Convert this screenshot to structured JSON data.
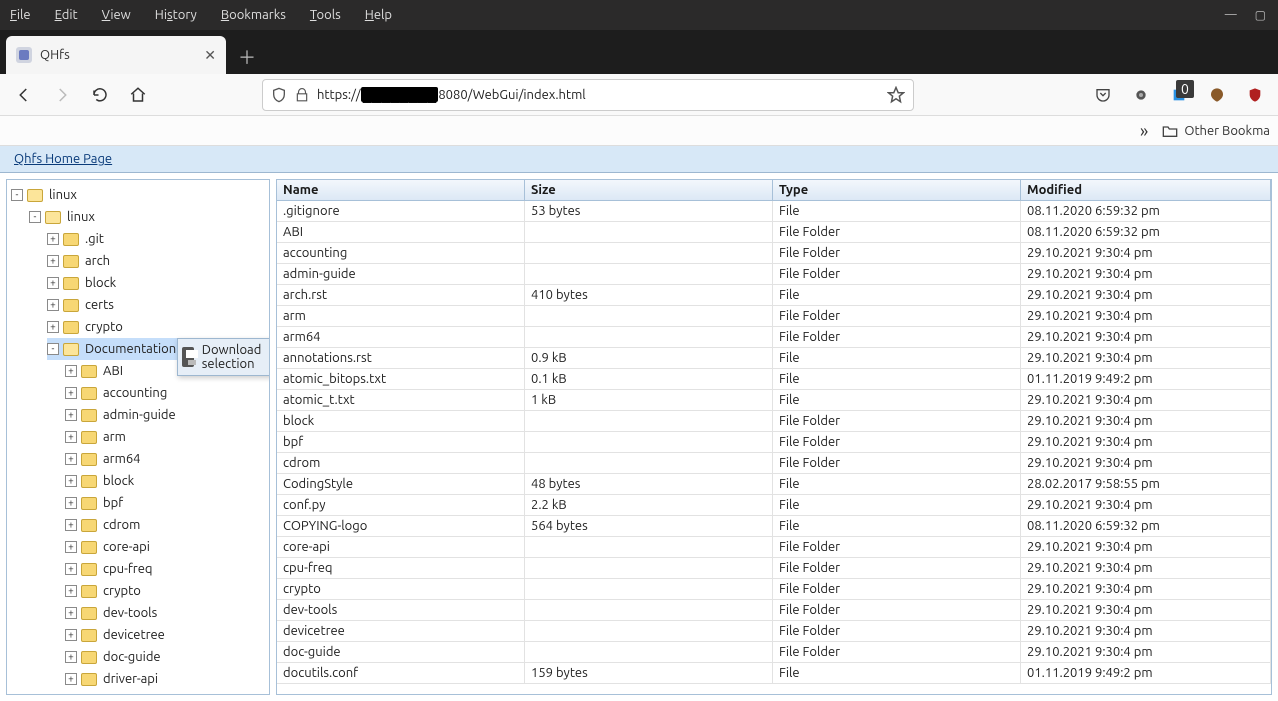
{
  "chrome": {
    "menus": [
      {
        "label": "File",
        "accel": "F"
      },
      {
        "label": "Edit",
        "accel": "E"
      },
      {
        "label": "View",
        "accel": "V"
      },
      {
        "label": "History",
        "accel": "s"
      },
      {
        "label": "Bookmarks",
        "accel": "B"
      },
      {
        "label": "Tools",
        "accel": "T"
      },
      {
        "label": "Help",
        "accel": "H"
      }
    ],
    "tab_title": "QHfs",
    "url_prefix": "https://",
    "url_redacted": "████████",
    "url_suffix": "8080/WebGui/index.html",
    "pocket_badge": "0",
    "bookmarks_overflow_label": "Other Bookma"
  },
  "page": {
    "home_link": "Qhfs Home Page",
    "ctx_download": "Download selection"
  },
  "tree": [
    {
      "depth": 0,
      "exp": "-",
      "open": true,
      "label": "linux",
      "selected": false
    },
    {
      "depth": 1,
      "exp": "-",
      "open": true,
      "label": "linux",
      "selected": false
    },
    {
      "depth": 2,
      "exp": "+",
      "open": false,
      "label": ".git",
      "selected": false
    },
    {
      "depth": 2,
      "exp": "+",
      "open": false,
      "label": "arch",
      "selected": false
    },
    {
      "depth": 2,
      "exp": "+",
      "open": false,
      "label": "block",
      "selected": false
    },
    {
      "depth": 2,
      "exp": "+",
      "open": false,
      "label": "certs",
      "selected": false
    },
    {
      "depth": 2,
      "exp": "+",
      "open": false,
      "label": "crypto",
      "selected": false
    },
    {
      "depth": 2,
      "exp": "-",
      "open": true,
      "label": "Documentation",
      "selected": true
    },
    {
      "depth": 3,
      "exp": "+",
      "open": false,
      "label": "ABI",
      "selected": false
    },
    {
      "depth": 3,
      "exp": "+",
      "open": false,
      "label": "accounting",
      "selected": false
    },
    {
      "depth": 3,
      "exp": "+",
      "open": false,
      "label": "admin-guide",
      "selected": false
    },
    {
      "depth": 3,
      "exp": "+",
      "open": false,
      "label": "arm",
      "selected": false
    },
    {
      "depth": 3,
      "exp": "+",
      "open": false,
      "label": "arm64",
      "selected": false
    },
    {
      "depth": 3,
      "exp": "+",
      "open": false,
      "label": "block",
      "selected": false
    },
    {
      "depth": 3,
      "exp": "+",
      "open": false,
      "label": "bpf",
      "selected": false
    },
    {
      "depth": 3,
      "exp": "+",
      "open": false,
      "label": "cdrom",
      "selected": false
    },
    {
      "depth": 3,
      "exp": "+",
      "open": false,
      "label": "core-api",
      "selected": false
    },
    {
      "depth": 3,
      "exp": "+",
      "open": false,
      "label": "cpu-freq",
      "selected": false
    },
    {
      "depth": 3,
      "exp": "+",
      "open": false,
      "label": "crypto",
      "selected": false
    },
    {
      "depth": 3,
      "exp": "+",
      "open": false,
      "label": "dev-tools",
      "selected": false
    },
    {
      "depth": 3,
      "exp": "+",
      "open": false,
      "label": "devicetree",
      "selected": false
    },
    {
      "depth": 3,
      "exp": "+",
      "open": false,
      "label": "doc-guide",
      "selected": false
    },
    {
      "depth": 3,
      "exp": "+",
      "open": false,
      "label": "driver-api",
      "selected": false
    }
  ],
  "grid": {
    "columns": [
      "Name",
      "Size",
      "Type",
      "Modified"
    ],
    "rows": [
      {
        "name": ".gitignore",
        "size": "53 bytes",
        "type": "File",
        "modified": "08.11.2020 6:59:32 pm"
      },
      {
        "name": "ABI",
        "size": "",
        "type": "File Folder",
        "modified": "08.11.2020 6:59:32 pm"
      },
      {
        "name": "accounting",
        "size": "",
        "type": "File Folder",
        "modified": "29.10.2021 9:30:4 pm"
      },
      {
        "name": "admin-guide",
        "size": "",
        "type": "File Folder",
        "modified": "29.10.2021 9:30:4 pm"
      },
      {
        "name": "arch.rst",
        "size": "410 bytes",
        "type": "File",
        "modified": "29.10.2021 9:30:4 pm"
      },
      {
        "name": "arm",
        "size": "",
        "type": "File Folder",
        "modified": "29.10.2021 9:30:4 pm"
      },
      {
        "name": "arm64",
        "size": "",
        "type": "File Folder",
        "modified": "29.10.2021 9:30:4 pm"
      },
      {
        "name": "annotations.rst",
        "size": "0.9 kB",
        "type": "File",
        "modified": "29.10.2021 9:30:4 pm"
      },
      {
        "name": "atomic_bitops.txt",
        "size": "0.1 kB",
        "type": "File",
        "modified": "01.11.2019 9:49:2 pm"
      },
      {
        "name": "atomic_t.txt",
        "size": "1 kB",
        "type": "File",
        "modified": "29.10.2021 9:30:4 pm"
      },
      {
        "name": "block",
        "size": "",
        "type": "File Folder",
        "modified": "29.10.2021 9:30:4 pm"
      },
      {
        "name": "bpf",
        "size": "",
        "type": "File Folder",
        "modified": "29.10.2021 9:30:4 pm"
      },
      {
        "name": "cdrom",
        "size": "",
        "type": "File Folder",
        "modified": "29.10.2021 9:30:4 pm"
      },
      {
        "name": "CodingStyle",
        "size": "48 bytes",
        "type": "File",
        "modified": "28.02.2017 9:58:55 pm"
      },
      {
        "name": "conf.py",
        "size": "2.2 kB",
        "type": "File",
        "modified": "29.10.2021 9:30:4 pm"
      },
      {
        "name": "COPYING-logo",
        "size": "564 bytes",
        "type": "File",
        "modified": "08.11.2020 6:59:32 pm"
      },
      {
        "name": "core-api",
        "size": "",
        "type": "File Folder",
        "modified": "29.10.2021 9:30:4 pm"
      },
      {
        "name": "cpu-freq",
        "size": "",
        "type": "File Folder",
        "modified": "29.10.2021 9:30:4 pm"
      },
      {
        "name": "crypto",
        "size": "",
        "type": "File Folder",
        "modified": "29.10.2021 9:30:4 pm"
      },
      {
        "name": "dev-tools",
        "size": "",
        "type": "File Folder",
        "modified": "29.10.2021 9:30:4 pm"
      },
      {
        "name": "devicetree",
        "size": "",
        "type": "File Folder",
        "modified": "29.10.2021 9:30:4 pm"
      },
      {
        "name": "doc-guide",
        "size": "",
        "type": "File Folder",
        "modified": "29.10.2021 9:30:4 pm"
      },
      {
        "name": "docutils.conf",
        "size": "159 bytes",
        "type": "File",
        "modified": "01.11.2019 9:49:2 pm"
      }
    ]
  }
}
